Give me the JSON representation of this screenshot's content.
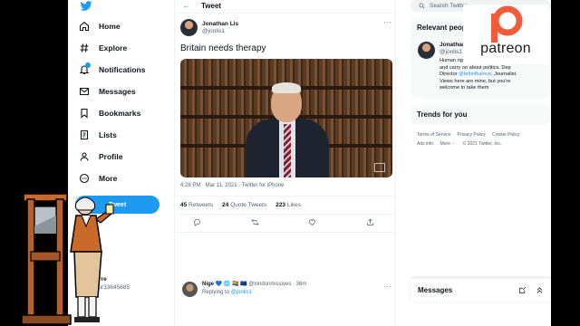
{
  "nav": {
    "items": [
      {
        "label": "Home",
        "icon": "home-icon"
      },
      {
        "label": "Explore",
        "icon": "hashtag-icon"
      },
      {
        "label": "Notifications",
        "icon": "bell-icon"
      },
      {
        "label": "Messages",
        "icon": "envelope-icon"
      },
      {
        "label": "Bookmarks",
        "icon": "bookmark-icon"
      },
      {
        "label": "Lists",
        "icon": "list-icon"
      },
      {
        "label": "Profile",
        "icon": "person-icon"
      },
      {
        "label": "More",
        "icon": "more-circle-icon"
      }
    ],
    "tweet_button": "Tweet",
    "account_name": "...bespierre",
    "account_handle": "@Robespr33645685"
  },
  "header": {
    "title": "Tweet"
  },
  "tweet": {
    "author_name": "Jonathan Lis",
    "author_handle": "@jonlis1",
    "text": "Britain needs therapy",
    "meta": "4:28 PM · Mar 11, 2021 · Twitter for iPhone",
    "retweets": "45",
    "retweets_label": "Retweets",
    "quotes": "24",
    "quotes_label": "Quote Tweets",
    "likes": "223",
    "likes_label": "Likes"
  },
  "reply": {
    "author_name": "Nige 💙 🌐 🏳️‍🌈 🇪🇺",
    "author_handle": "@londonmissives · 36m",
    "replying_prefix": "Replying to",
    "replying_handle": "@jonlis1"
  },
  "sidebar": {
    "search_placeholder": "Search Twitter",
    "relevant_title": "Relevant peop",
    "person_name": "Jonathan",
    "person_handle": "@jonlis1",
    "bio_1": "Human rig",
    "bio_2": "and carry on about politics. Dep",
    "bio_3_prefix": "Director ",
    "bio_3_link": "@britinfluence",
    "bio_3_suffix": ". Journalist.",
    "bio_4": "Views here are mine, but you're",
    "bio_5": "welcome to take them",
    "trends_title": "Trends for you",
    "footer_links": [
      "Terms of Service",
      "Privacy Policy",
      "Cookie Policy"
    ],
    "footer_links_2": [
      "Ads info",
      "More ···",
      "© 2021 Twitter, Inc."
    ],
    "messages_title": "Messages"
  },
  "overlay": {
    "patreon_word": "patreon"
  },
  "colors": {
    "accent": "#1d9bf0",
    "text": "#0f1419",
    "muted": "#536471"
  }
}
